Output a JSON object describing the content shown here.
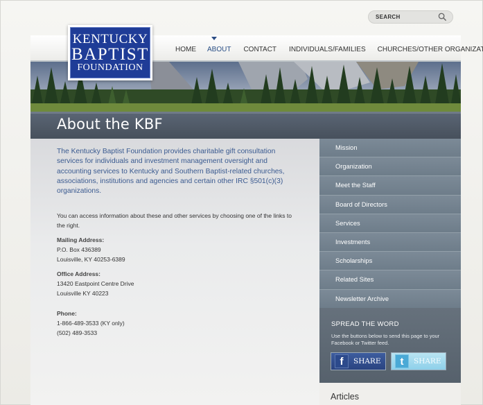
{
  "search": {
    "placeholder": "SEARCH"
  },
  "logo": {
    "line1": "KENTUCKY",
    "line2": "BAPTIST",
    "line3": "FOUNDATION"
  },
  "nav": {
    "items": [
      {
        "label": "HOME"
      },
      {
        "label": "ABOUT"
      },
      {
        "label": "CONTACT"
      },
      {
        "label": "INDIVIDUALS/FAMILIES"
      },
      {
        "label": "CHURCHES/OTHER ORGANIZATIONS"
      }
    ],
    "active": "ABOUT"
  },
  "page": {
    "title": "About the KBF"
  },
  "content": {
    "intro": "The Kentucky Baptist Foundation provides charitable gift consultation services for individuals and investment management oversight and accounting services to Kentucky and Southern Baptist-related churches, associations, institutions and agencies and certain other IRC §501(c)(3) organizations.",
    "access": "You can access information about these and other services by choosing one of the links to the right.",
    "mailing_label": "Mailing Address:",
    "mailing_line1": "P.O. Box 436389",
    "mailing_line2": "Louisville, KY 40253-6389",
    "office_label": "Office Address:",
    "office_line1": "13420 Eastpoint Centre Drive",
    "office_line2": "Louisville KY 40223",
    "phone_label": "Phone:",
    "phone_line1": "1-866-489-3533 (KY only)",
    "phone_line2": "(502) 489-3533"
  },
  "sidebar": {
    "items": [
      {
        "label": "Mission"
      },
      {
        "label": "Organization"
      },
      {
        "label": "Meet the Staff"
      },
      {
        "label": "Board of Directors"
      },
      {
        "label": "Services"
      },
      {
        "label": "Investments"
      },
      {
        "label": "Scholarships"
      },
      {
        "label": "Related Sites"
      },
      {
        "label": "Newsletter Archive"
      }
    ]
  },
  "spread": {
    "title": "SPREAD THE WORD",
    "description": "Use the buttons below to send this page to your Facebook or Twitter feed.",
    "facebook_label": "SHARE",
    "twitter_label": "SHARE"
  },
  "articles": {
    "title": "Articles"
  },
  "colors": {
    "brand_blue": "#1f3c97",
    "intro_text": "#3a5a90",
    "sidebar": "#71808d",
    "facebook": "#2a4380",
    "twitter": "#8ed0ea"
  }
}
